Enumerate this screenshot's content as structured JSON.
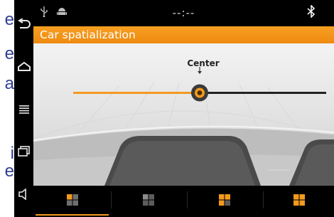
{
  "background_fragments": [
    "e",
    "e",
    "a",
    "i",
    "e"
  ],
  "status_bar": {
    "clock": "--:--",
    "icons": [
      "usb-icon",
      "android-debug-icon",
      "bluetooth-icon"
    ]
  },
  "screen": {
    "title": "Car spatialization"
  },
  "slider": {
    "label": "Center",
    "value": 0.5
  },
  "nav": [
    "back-icon",
    "home-icon",
    "menu-icon",
    "recent-apps-icon",
    "volume-icon"
  ],
  "tabs": [
    {
      "name": "left",
      "selected": true
    },
    {
      "name": "center-left",
      "selected": false
    },
    {
      "name": "center-right",
      "selected": false
    },
    {
      "name": "right",
      "selected": false
    }
  ],
  "colors": {
    "accent": "#f39a1e",
    "title_bar": "#f39a1e",
    "status_bar": "#000000"
  }
}
